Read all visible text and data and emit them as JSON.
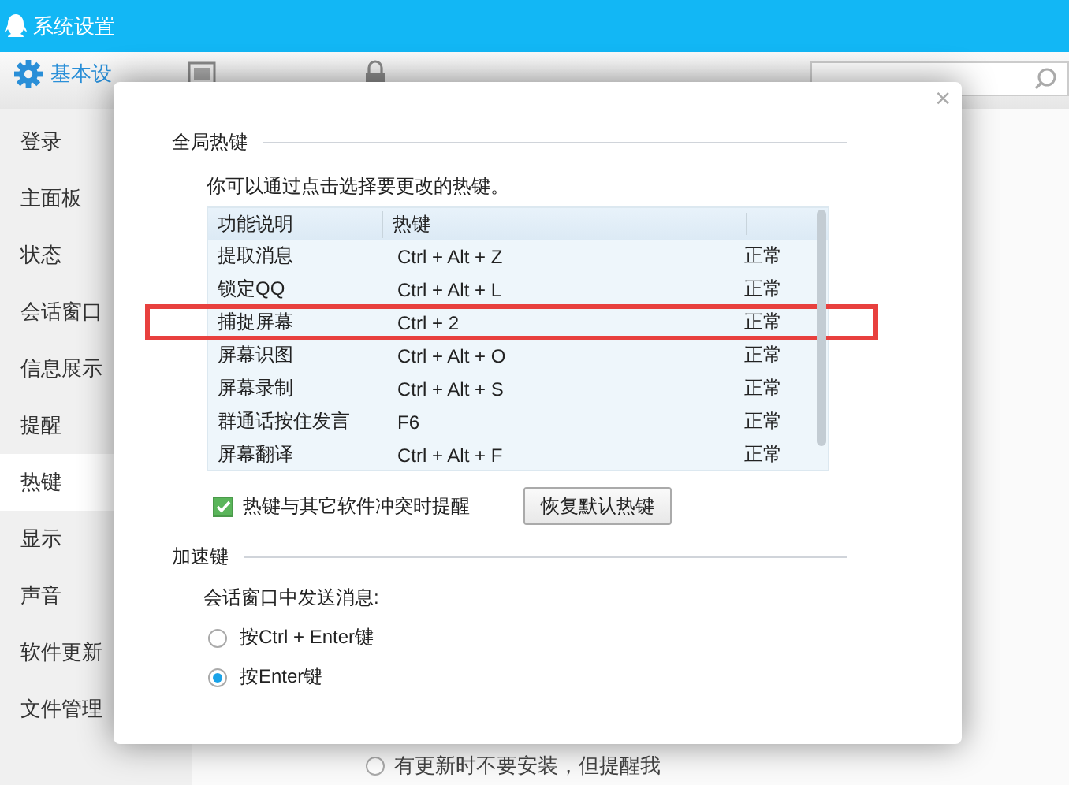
{
  "window": {
    "title": "系统设置"
  },
  "tabs": [
    {
      "label": "基本设",
      "selected": true
    },
    {
      "selected": false
    },
    {
      "selected": false
    }
  ],
  "sidebar": {
    "items": [
      {
        "label": "登录",
        "selected": false
      },
      {
        "label": "主面板",
        "selected": false
      },
      {
        "label": "状态",
        "selected": false
      },
      {
        "label": "会话窗口",
        "selected": false
      },
      {
        "label": "信息展示",
        "selected": false
      },
      {
        "label": "提醒",
        "selected": false
      },
      {
        "label": "热键",
        "selected": true
      },
      {
        "label": "显示",
        "selected": false
      },
      {
        "label": "声音",
        "selected": false
      },
      {
        "label": "软件更新",
        "selected": false
      },
      {
        "label": "文件管理",
        "selected": false
      }
    ]
  },
  "background_option": {
    "label": "有更新时不要安装，但提醒我",
    "selected": false
  },
  "dialog": {
    "close": "×",
    "global_hotkeys": {
      "heading": "全局热键",
      "hint": "你可以通过点击选择要更改的热键。",
      "table": {
        "columns": [
          "功能说明",
          "热键"
        ],
        "rows": [
          {
            "function": "提取消息",
            "hotkey": "Ctrl + Alt + Z",
            "status": "正常",
            "highlighted": false
          },
          {
            "function": "锁定QQ",
            "hotkey": "Ctrl + Alt + L",
            "status": "正常",
            "highlighted": false
          },
          {
            "function": "捕捉屏幕",
            "hotkey": "Ctrl + 2",
            "status": "正常",
            "highlighted": true
          },
          {
            "function": "屏幕识图",
            "hotkey": "Ctrl + Alt + O",
            "status": "正常",
            "highlighted": false
          },
          {
            "function": "屏幕录制",
            "hotkey": "Ctrl + Alt + S",
            "status": "正常",
            "highlighted": false
          },
          {
            "function": "群通话按住发言",
            "hotkey": "F6",
            "status": "正常",
            "highlighted": false
          },
          {
            "function": "屏幕翻译",
            "hotkey": "Ctrl + Alt + F",
            "status": "正常",
            "highlighted": false
          }
        ]
      },
      "conflict_alert": {
        "label": "热键与其它软件冲突时提醒",
        "checked": true
      },
      "restore_button": "恢复默认热键"
    },
    "accelerator": {
      "heading": "加速键",
      "prompt": "会话窗口中发送消息:",
      "options": [
        {
          "label": "按Ctrl + Enter键",
          "selected": false
        },
        {
          "label": "按Enter键",
          "selected": true
        }
      ]
    }
  }
}
